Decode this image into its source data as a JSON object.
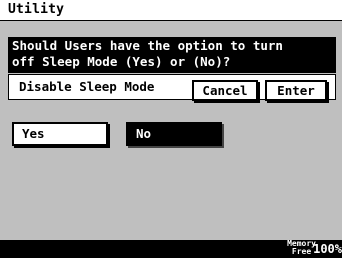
{
  "title": "Utility",
  "message": {
    "line1": "Should Users have the option to turn",
    "line2": "off Sleep Mode (Yes) or (No)?"
  },
  "setting": {
    "label": "Disable Sleep Mode",
    "cancel_label": "Cancel",
    "enter_label": "Enter"
  },
  "options": {
    "yes_label": "Yes",
    "no_label": "No",
    "selected": "No"
  },
  "status": {
    "memory_label_line1": "Memory",
    "memory_label_line2": "Free",
    "memory_value": "100%"
  },
  "colors": {
    "selected_bg": "#000000",
    "unselected_bg": "#ffffff"
  }
}
